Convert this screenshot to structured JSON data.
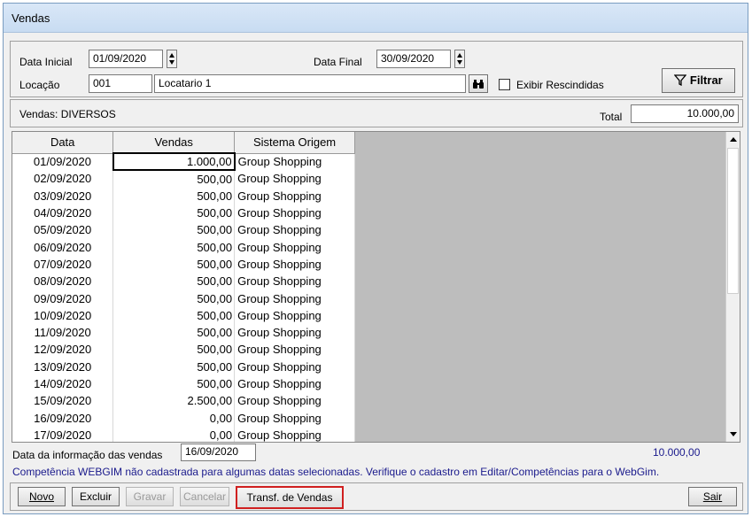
{
  "window": {
    "title": "Vendas"
  },
  "filters": {
    "data_inicial_label": "Data Inicial",
    "data_inicial_value": "01/09/2020",
    "data_final_label": "Data Final",
    "data_final_value": "30/09/2020",
    "locacao_label": "Locação",
    "locacao_code": "001",
    "locacao_name": "Locatario 1",
    "exibir_label": "Exibir Rescindidas",
    "filtrar_label": "Filtrar"
  },
  "summary": {
    "vendas_label": "Vendas: DIVERSOS",
    "total_label": "Total",
    "total_value": "10.000,00"
  },
  "grid": {
    "headers": [
      "Data",
      "Vendas",
      "Sistema Origem"
    ],
    "rows": [
      [
        "01/09/2020",
        "1.000,00",
        "Group Shopping"
      ],
      [
        "02/09/2020",
        "500,00",
        "Group Shopping"
      ],
      [
        "03/09/2020",
        "500,00",
        "Group Shopping"
      ],
      [
        "04/09/2020",
        "500,00",
        "Group Shopping"
      ],
      [
        "05/09/2020",
        "500,00",
        "Group Shopping"
      ],
      [
        "06/09/2020",
        "500,00",
        "Group Shopping"
      ],
      [
        "07/09/2020",
        "500,00",
        "Group Shopping"
      ],
      [
        "08/09/2020",
        "500,00",
        "Group Shopping"
      ],
      [
        "09/09/2020",
        "500,00",
        "Group Shopping"
      ],
      [
        "10/09/2020",
        "500,00",
        "Group Shopping"
      ],
      [
        "11/09/2020",
        "500,00",
        "Group Shopping"
      ],
      [
        "12/09/2020",
        "500,00",
        "Group Shopping"
      ],
      [
        "13/09/2020",
        "500,00",
        "Group Shopping"
      ],
      [
        "14/09/2020",
        "500,00",
        "Group Shopping"
      ],
      [
        "15/09/2020",
        "2.500,00",
        "Group Shopping"
      ],
      [
        "16/09/2020",
        "0,00",
        "Group Shopping"
      ],
      [
        "17/09/2020",
        "0,00",
        "Group Shopping"
      ]
    ]
  },
  "footer": {
    "info_label": "Data da informação das vendas",
    "info_value": "16/09/2020",
    "sum_value": "10.000,00",
    "warning": "Competência WEBGIM não cadastrada para algumas datas selecionadas. Verifique o cadastro em Editar/Competências para o WebGim."
  },
  "buttons": {
    "novo": "Novo",
    "excluir": "Excluir",
    "gravar": "Gravar",
    "cancelar": "Cancelar",
    "transf": "Transf. de Vendas",
    "sair": "Sair"
  },
  "colors": {
    "warning_text": "#1a1a8c",
    "highlight_border": "#d02020"
  },
  "icons": {
    "search": "binoculars-icon",
    "filter": "funnel-icon"
  }
}
